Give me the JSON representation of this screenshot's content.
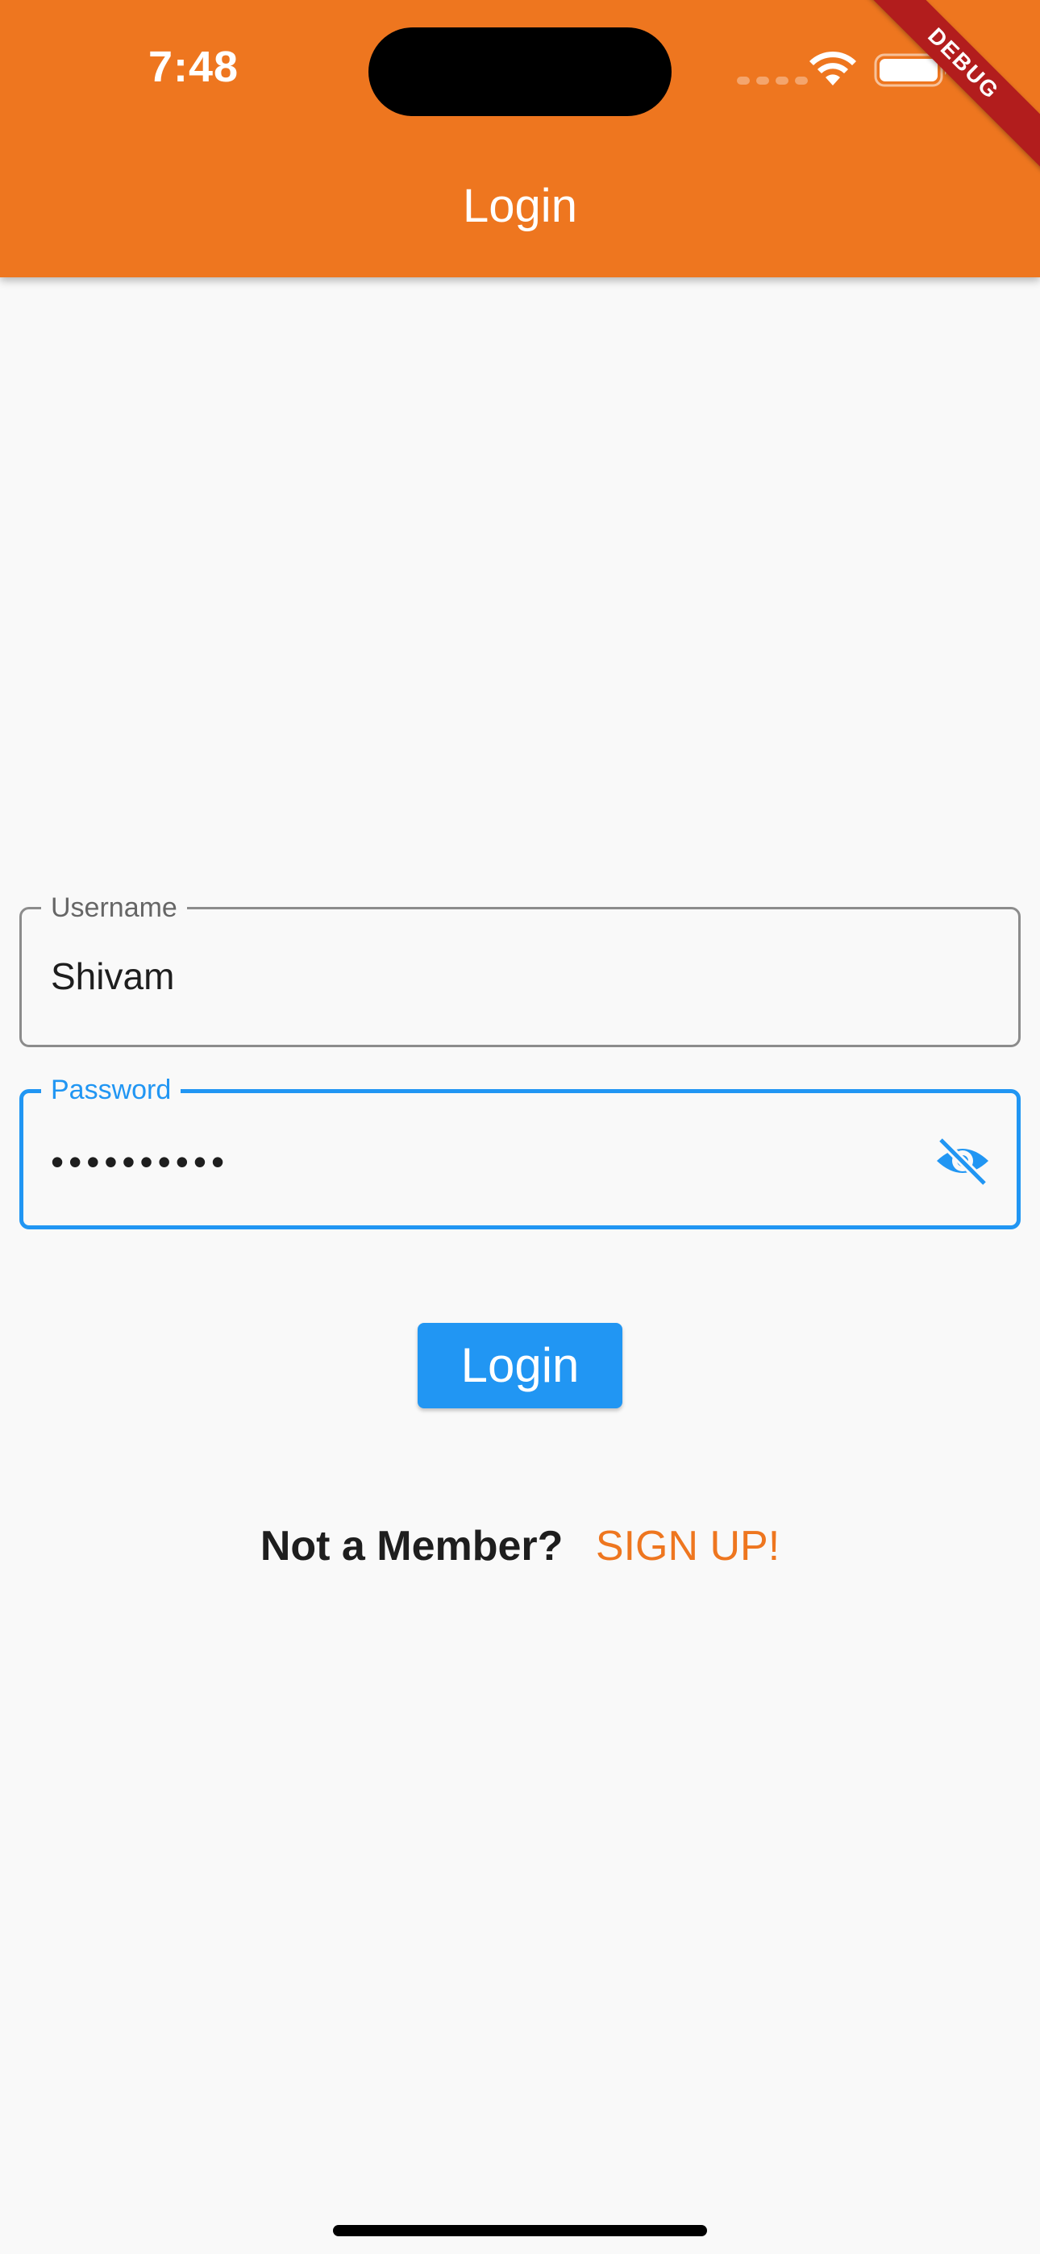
{
  "status_bar": {
    "time": "7:48"
  },
  "app_bar": {
    "title": "Login",
    "debug_banner": "DEBUG",
    "color": "#ee761f"
  },
  "form": {
    "username": {
      "label": "Username",
      "value": "Shivam"
    },
    "password": {
      "label": "Password",
      "masked_value": "••••••••••",
      "visibility_icon": "visibility-off-icon"
    },
    "login_button": "Login"
  },
  "signup": {
    "prompt": "Not a Member?",
    "link": "SIGN UP!"
  },
  "colors": {
    "accent": "#2196f3",
    "brand": "#ee761f"
  }
}
